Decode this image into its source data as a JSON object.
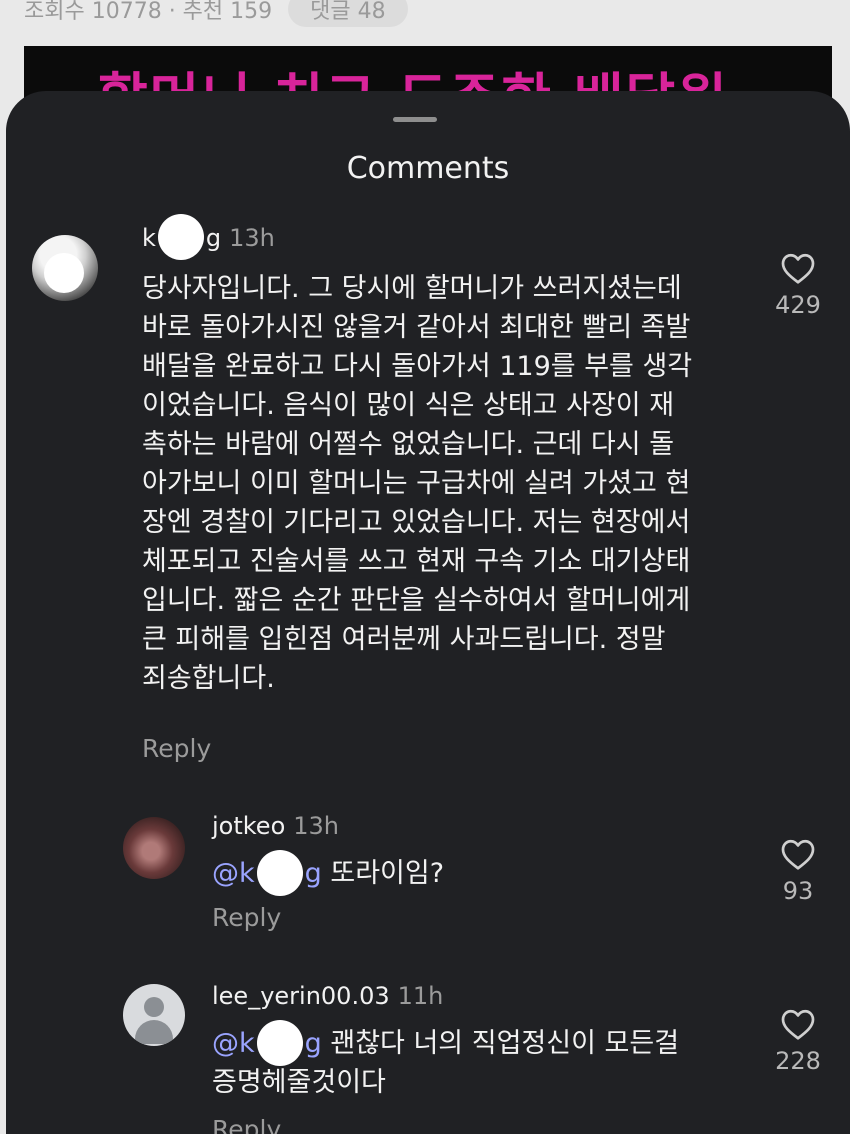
{
  "background": {
    "stats_text": "조회수 10778 · 추천 159",
    "comment_pill": "댓글 48",
    "banner_text": "할머니 치고 도주한 배달원"
  },
  "sheet": {
    "title": "Comments"
  },
  "comments": [
    {
      "username_prefix": "k",
      "username_suffix": "g",
      "time": "13h",
      "body": "당사자입니다. 그 당시에 할머니가 쓰러지셨는데\n바로 돌아가시진 않을거 같아서 최대한 빨리 족발\n배달을 완료하고 다시 돌아가서 119를 부를 생각\n이었습니다. 음식이 많이 식은 상태고 사장이 재\n촉하는 바람에 어쩔수 없었습니다. 근데 다시 돌\n아가보니 이미 할머니는 구급차에 실려 가셨고 현\n장엔 경찰이 기다리고 있었습니다. 저는 현장에서\n체포되고 진술서를 쓰고 현재 구속 기소 대기상태\n입니다. 짧은 순간 판단을 실수하여서 할머니에게\n큰 피해를 입힌점 여러분께 사과드립니다. 정말\n죄송합니다.",
      "reply_label": "Reply",
      "likes": "429"
    },
    {
      "username": "jotkeo",
      "time": "13h",
      "mention_prefix": "@k",
      "mention_suffix": "g",
      "body": " 또라이임?",
      "reply_label": "Reply",
      "likes": "93"
    },
    {
      "username": "lee_yerin00.03",
      "time": "11h",
      "mention_prefix": "@k",
      "mention_suffix": "g",
      "body_line1": " 괜찮다 너의 직업정신이 모든걸",
      "body_line2": "증명헤줄것이다",
      "reply_label": "Reply",
      "likes": "228"
    }
  ],
  "icons": {
    "like": "heart-outline-icon",
    "mention": "threads-at-icon",
    "redaction": "white-circle-redaction"
  },
  "colors": {
    "sheet_bg": "#202124",
    "text": "#f2f2f2",
    "muted": "#9b9b9b",
    "mention": "#9aa4ff"
  }
}
